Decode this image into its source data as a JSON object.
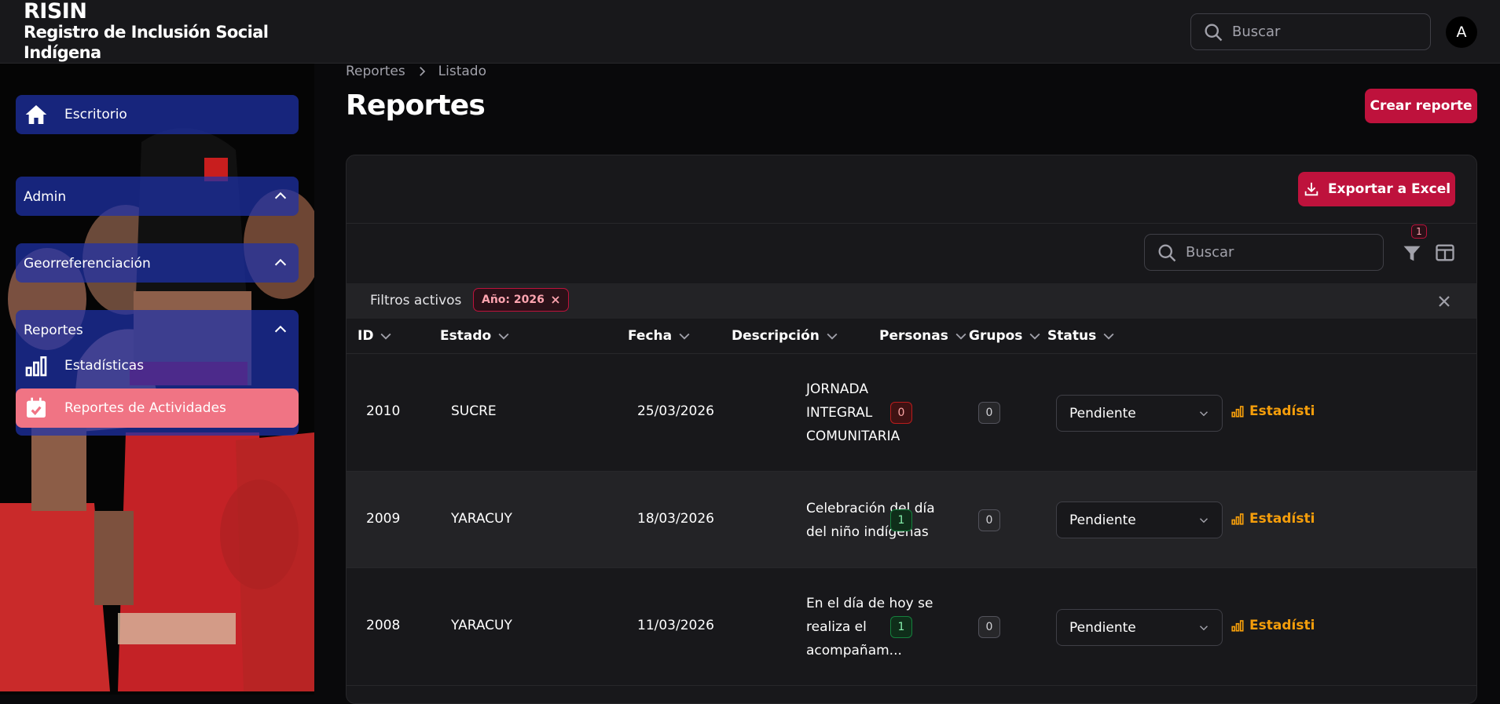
{
  "app": {
    "brand": "RISIN",
    "subtitle_line1": "Registro de Inclusión Social",
    "subtitle_line2": "Indígena",
    "avatar_initial": "A"
  },
  "search": {
    "placeholder": "Buscar"
  },
  "sidebar": {
    "escritorio": "Escritorio",
    "groups": [
      {
        "label": "Admin"
      },
      {
        "label": "Georreferenciación"
      },
      {
        "label": "Reportes"
      }
    ],
    "items": [
      {
        "label": "Estadísticas",
        "icon": "bar-chart-icon"
      },
      {
        "label": "Reportes de Actividades",
        "icon": "calendar-check-icon",
        "active": true
      }
    ]
  },
  "breadcrumb": {
    "root": "Reportes",
    "current": "Listado"
  },
  "page": {
    "title": "Reportes",
    "create_button": "Crear reporte"
  },
  "table": {
    "export_button": "Exportar a Excel",
    "search_placeholder": "Buscar",
    "filter_count": "1",
    "active_filters_label": "Filtros activos",
    "active_filter_chip": "Año: 2026",
    "columns": [
      "ID",
      "Estado",
      "Fecha",
      "Descripción",
      "Personas",
      "Grupos",
      "Status"
    ],
    "rows": [
      {
        "id": "2010",
        "estado": "SUCRE",
        "fecha": "25/03/2026",
        "desc1": "JORNADA",
        "desc2": "INTEGRAL",
        "desc3": "COMUNITARIA",
        "personas": "0",
        "grupos": "0",
        "status": "Pendiente",
        "link": "Estadísti"
      },
      {
        "id": "2009",
        "estado": "YARACUY",
        "fecha": "18/03/2026",
        "desc1": "Celebración del día",
        "desc2": "del niño indígenas",
        "desc3": "",
        "personas": "1",
        "grupos": "0",
        "status": "Pendiente",
        "link": "Estadísti"
      },
      {
        "id": "2008",
        "estado": "YARACUY",
        "fecha": "11/03/2026",
        "desc1": "En el día de hoy se",
        "desc2": "realiza el",
        "desc3": "acompañam...",
        "personas": "1",
        "grupos": "0",
        "status": "Pendiente",
        "link": "Estadísti"
      }
    ]
  },
  "colors": {
    "primary": "#be123c",
    "active_nav": "#f07484",
    "nav_group": "#1e32aa",
    "warning_link": "#f59e0b"
  }
}
